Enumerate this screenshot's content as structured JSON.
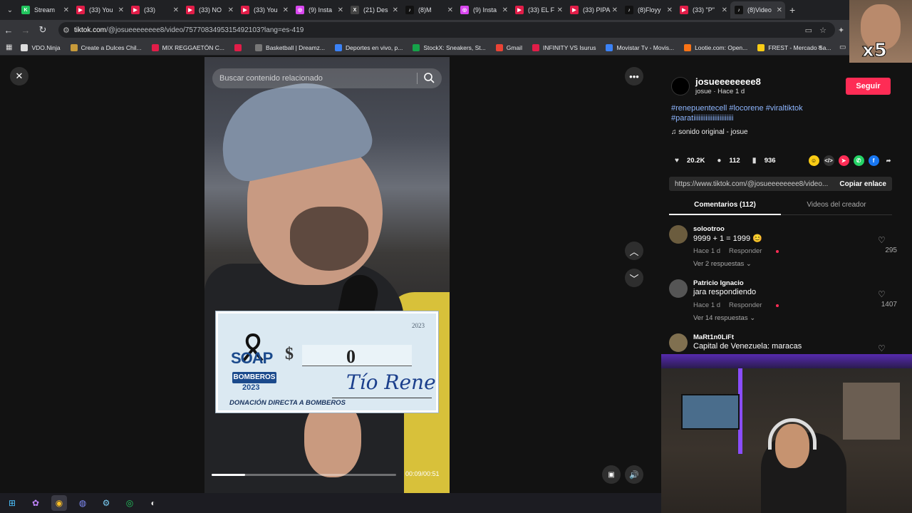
{
  "tabs": [
    {
      "label": "Stream",
      "color": "#22c55e",
      "icon": "K"
    },
    {
      "label": "(33) You",
      "color": "#e11d48",
      "icon": "▶"
    },
    {
      "label": "(33)",
      "color": "#e11d48",
      "icon": "▶"
    },
    {
      "label": "(33) NO",
      "color": "#e11d48",
      "icon": "▶"
    },
    {
      "label": "(33) You",
      "color": "#e11d48",
      "icon": "▶"
    },
    {
      "label": "(9) Insta",
      "color": "#d946ef",
      "icon": "◎"
    },
    {
      "label": "(21) Des",
      "color": "#444",
      "icon": "X"
    },
    {
      "label": "(8)M",
      "color": "#111",
      "icon": "♪"
    },
    {
      "label": "(9) Insta",
      "color": "#d946ef",
      "icon": "◎"
    },
    {
      "label": "(33) EL F",
      "color": "#e11d48",
      "icon": "▶"
    },
    {
      "label": "(33) PIPA",
      "color": "#e11d48",
      "icon": "▶"
    },
    {
      "label": "(8)Floyy",
      "color": "#111",
      "icon": "♪"
    },
    {
      "label": "(33) \"P\"",
      "color": "#e11d48",
      "icon": "▶"
    },
    {
      "label": "(8)Video",
      "color": "#111",
      "icon": "♪",
      "active": true
    }
  ],
  "address": {
    "host": "tiktok.com",
    "path": "/@josueeeeeeee8/video/7577083495315492103?lang=es-419"
  },
  "bookmarks": [
    {
      "label": "VDO.Ninja",
      "color": "#ddd"
    },
    {
      "label": "Create a Dulces Chil...",
      "color": "#c79a3a"
    },
    {
      "label": "MIX REGGAETÓN C...",
      "color": "#e11d48"
    },
    {
      "label": "",
      "color": "#e11d48"
    },
    {
      "label": "Basketball | Dreamz...",
      "color": "#777"
    },
    {
      "label": "Deportes en vivo, p...",
      "color": "#3b82f6"
    },
    {
      "label": "StockX: Sneakers, St...",
      "color": "#16a34a"
    },
    {
      "label": "Gmail",
      "color": "#ea4335"
    },
    {
      "label": "INFINITY VS Isurus",
      "color": "#e11d48"
    },
    {
      "label": "Movistar Tv - Movis...",
      "color": "#3b82f6"
    },
    {
      "label": "Lootie.com: Open...",
      "color": "#f97316"
    },
    {
      "label": "FREST - Mercado Sa...",
      "color": "#facc15"
    }
  ],
  "video": {
    "search_placeholder": "Buscar contenido relacionado",
    "cheque_year": "2023",
    "cheque_soap": "SOAP",
    "cheque_bomberos": "BOMBEROS",
    "cheque_by_year": "2023",
    "cheque_dollar": "$",
    "cheque_amount": "0",
    "cheque_signature": "Tío Rene",
    "cheque_footer": "DONACIÓN DIRECTA A BOMBEROS",
    "time": "00:09/00:51",
    "progress": 0.18
  },
  "panel": {
    "username": "josueeeeeeee8",
    "subline": "josue · Hace 1 d",
    "follow": "Seguir",
    "hashtags": "#renepuentecell #locorene #viraltiktok #paratiiiiiiiiiiiiiiiiiiiiiii",
    "sound": "sonido original - josue",
    "likes": "20.2K",
    "comments_count": "112",
    "saves": "936",
    "link": "https://www.tiktok.com/@josueeeeeeee8/video...",
    "copy": "Copiar enlace",
    "tab_comments": "Comentarios (112)",
    "tab_videos": "Videos del creador"
  },
  "comments": [
    {
      "user": "solootroo",
      "text": "9999 + 1 = 1999 😊",
      "time": "Hace 1 d",
      "reply": "Responder",
      "more": "Ver 2 respuestas ⌄",
      "likes": "295",
      "avatar": "#6b5c3e"
    },
    {
      "user": "Patricio Ignacio",
      "text": "jara respondiendo",
      "time": "Hace 1 d",
      "reply": "Responder",
      "more": "Ver 14 respuestas ⌄",
      "likes": "1407",
      "avatar": "#555"
    },
    {
      "user": "MaRt1n0LiFt",
      "text": "Capital de Venezuela: maracas",
      "time": "",
      "reply": "",
      "more": "",
      "likes": "",
      "avatar": "#807050"
    }
  ],
  "meme": {
    "badge": "x5"
  }
}
